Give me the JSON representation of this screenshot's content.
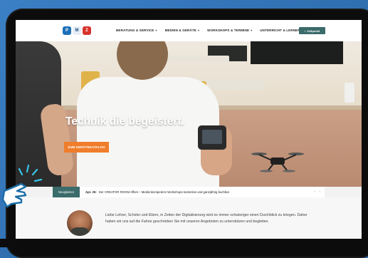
{
  "logo": {
    "letters": [
      "P",
      "M",
      "Z"
    ]
  },
  "nav": {
    "items": [
      "BERATUNG & SERVICE",
      "MEDIEN & GERÄTE",
      "WORKSHOPS & TERMINE",
      "UNTERRICHT & LERNEN"
    ],
    "cta_label": "Zeitpunkt"
  },
  "hero": {
    "title": "Technik die begeistert.",
    "button": "ZUM GERÄTEKATALOG"
  },
  "ticker": {
    "label": "Neuigkeiten",
    "date": "Apr. 25:",
    "text": "Der CREATOR ROOM öffnet – Medienkompetenz-Workshops kostenlos und ganzjährig buchbar"
  },
  "intro": {
    "text": "Liebe Lehrer, Schüler und Eltern, in Zeiten der Digitalisierung wird es immer schwieriger einen Durchblick zu kriegen. Daher haben wir uns auf die Fahne geschrieben Sie mit unseren Angeboten zu unterstützen und begleiten."
  },
  "colors": {
    "accent_teal": "#3b6b6a",
    "accent_orange": "#f07d2b",
    "logo_red": "#d8322d",
    "logo_blue": "#1d6fb8",
    "frame_blue": "#2f6fb0"
  }
}
